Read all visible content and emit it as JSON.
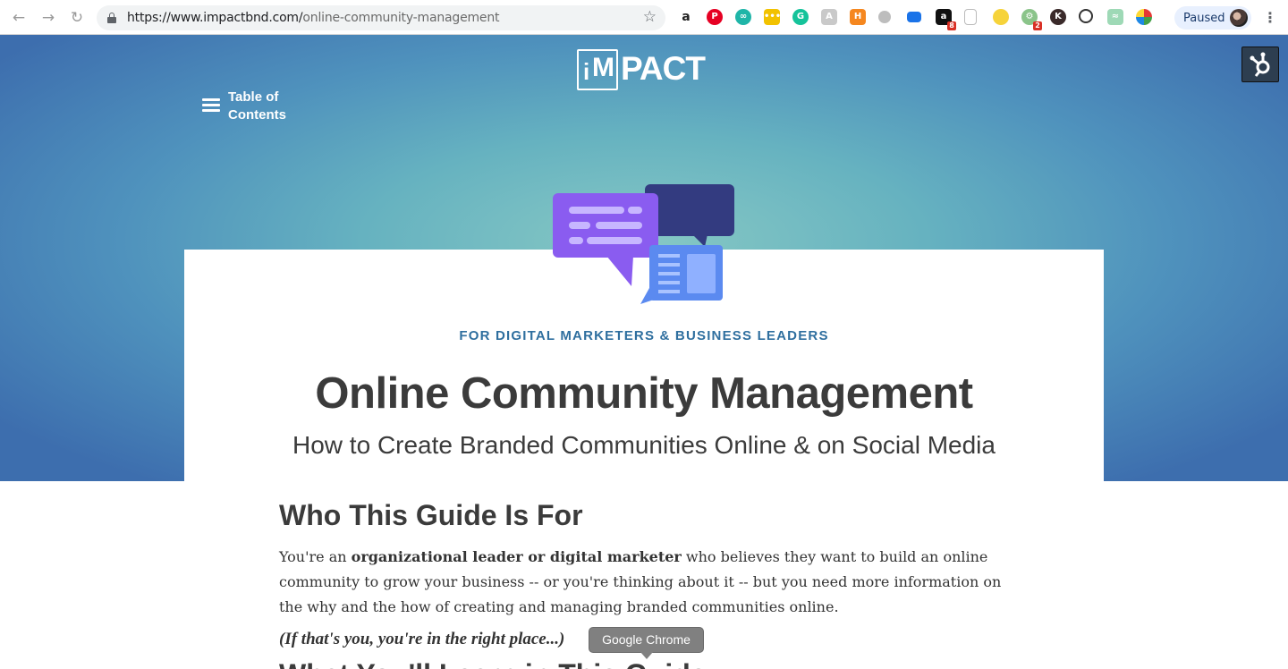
{
  "browser": {
    "url_host": "https://www.impactbnd.com/",
    "url_path": "online-community-management",
    "profile_label": "Paused",
    "extension_badges": {
      "amazon": "8",
      "ext_gear": "2"
    },
    "tooltip": "Google Chrome"
  },
  "header": {
    "toc_label": "Table of Contents",
    "logo_box_i": "i",
    "logo_box_m": "M",
    "logo_text": "PACT"
  },
  "hero": {
    "eyebrow": "FOR DIGITAL MARKETERS & BUSINESS LEADERS",
    "title": "Online Community Management",
    "subtitle": "How to Create Branded Communities Online & on Social Media"
  },
  "content": {
    "section_title": "Who This Guide Is For",
    "para_before": "You're an ",
    "para_bold": "organizational leader or digital marketer",
    "para_after": " who believes they want to build an online community to grow your business -- or you're thinking about it -- but you need more information on the why and the how of creating and managing branded communities online.",
    "aside": "(If that's you, you're in the right place...)",
    "next_section_title": "What You'll Learn in This Guide"
  },
  "colors": {
    "eyebrow": "#2f6f9f",
    "heading": "#3b3b3b",
    "hero_center": "#86c8c4",
    "hero_edge": "#3d6eae"
  }
}
